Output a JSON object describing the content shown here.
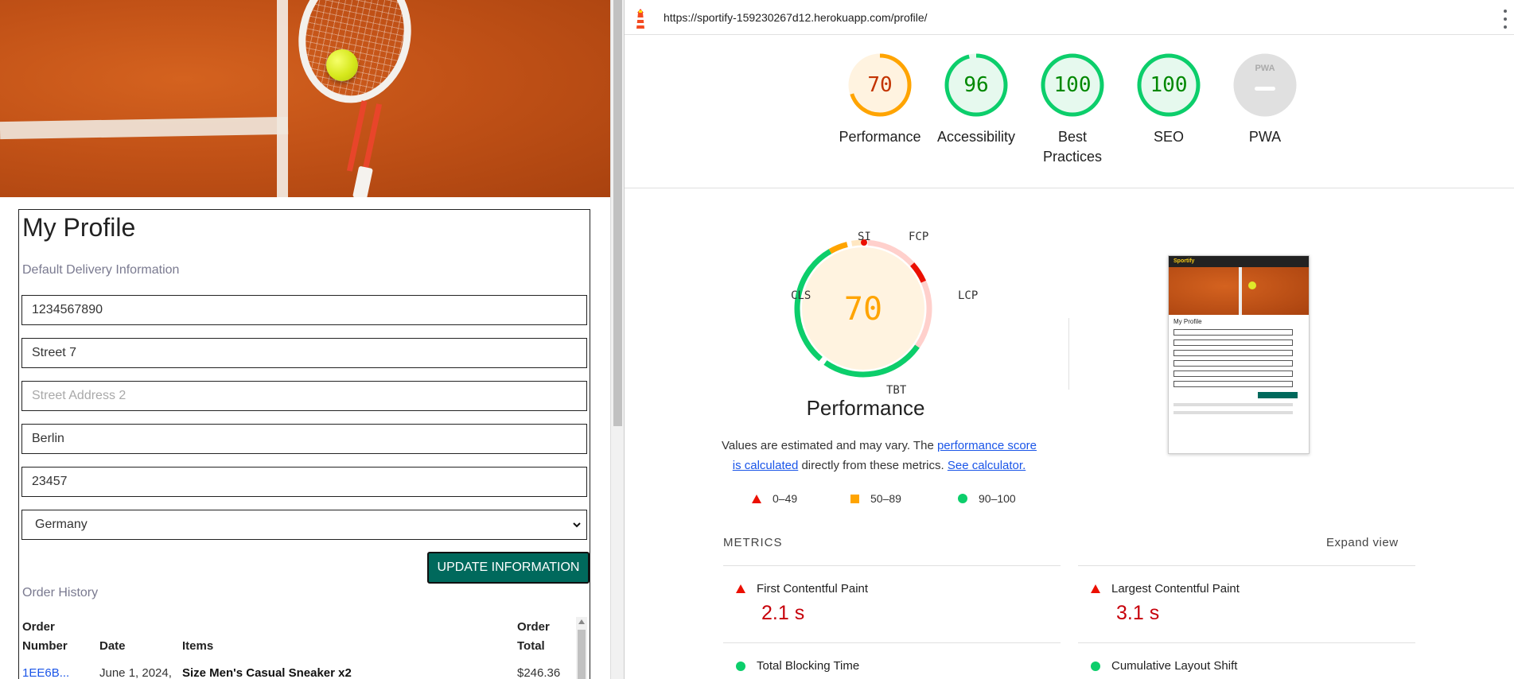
{
  "site": {
    "profile_title": "My Profile",
    "delivery_label": "Default Delivery Information",
    "fields": {
      "phone": "1234567890",
      "street1": "Street 7",
      "street2_placeholder": "Street Address 2",
      "city": "Berlin",
      "postcode": "23457",
      "country": "Germany"
    },
    "update_button": "UPDATE INFORMATION",
    "history_label": "Order History",
    "table_headers": {
      "order_number": [
        "Order",
        "Number"
      ],
      "date": "Date",
      "items": "Items",
      "order_total": [
        "Order",
        "Total"
      ]
    },
    "order_row": {
      "order_number": "1EE6B...",
      "date": "June 1, 2024,",
      "items": "Size Men's Casual Sneaker x2",
      "total": "$246.36"
    }
  },
  "lighthouse": {
    "url": "https://sportify-159230267d12.herokuapp.com/profile/",
    "scores": [
      {
        "label": "Performance",
        "value": "70",
        "score": 70,
        "color": "#ffa400",
        "text_color": "#c33300",
        "bg": "#fff3e0"
      },
      {
        "label": "Accessibility",
        "value": "96",
        "score": 96,
        "color": "#0cce6b",
        "text_color": "#008800",
        "bg": "#e6f9ee"
      },
      {
        "label": "Best Practices",
        "value": "100",
        "score": 100,
        "color": "#0cce6b",
        "text_color": "#008800",
        "bg": "#e6f9ee"
      },
      {
        "label": "SEO",
        "value": "100",
        "score": 100,
        "color": "#0cce6b",
        "text_color": "#008800",
        "bg": "#e6f9ee"
      },
      {
        "label": "PWA",
        "value": "PWA",
        "score": null,
        "color": "#cccccc",
        "text_color": "#9e9e9e",
        "bg": "#e0e0e0"
      }
    ],
    "big_score": "70",
    "big_title": "Performance",
    "gauge_tags": {
      "si": "SI",
      "fcp": "FCP",
      "lcp": "LCP",
      "cls": "CLS",
      "tbt": "TBT"
    },
    "estimate": {
      "prefix": "Values are estimated and may vary. The ",
      "link1": "performance score is calculated",
      "middle": " directly from these metrics. ",
      "link2": "See calculator."
    },
    "legend": {
      "red": "0–49",
      "orange": "50–89",
      "green": "90–100"
    },
    "metrics_heading": "METRICS",
    "expand_view": "Expand view",
    "metrics": [
      {
        "name": "First Contentful Paint",
        "value": "2.1 s",
        "status": "red"
      },
      {
        "name": "Largest Contentful Paint",
        "value": "3.1 s",
        "status": "red"
      },
      {
        "name": "Total Blocking Time",
        "value": "",
        "status": "green"
      },
      {
        "name": "Cumulative Layout Shift",
        "value": "",
        "status": "green"
      }
    ],
    "thumbnail": {
      "brand": "Sportify",
      "title": "My Profile"
    }
  }
}
